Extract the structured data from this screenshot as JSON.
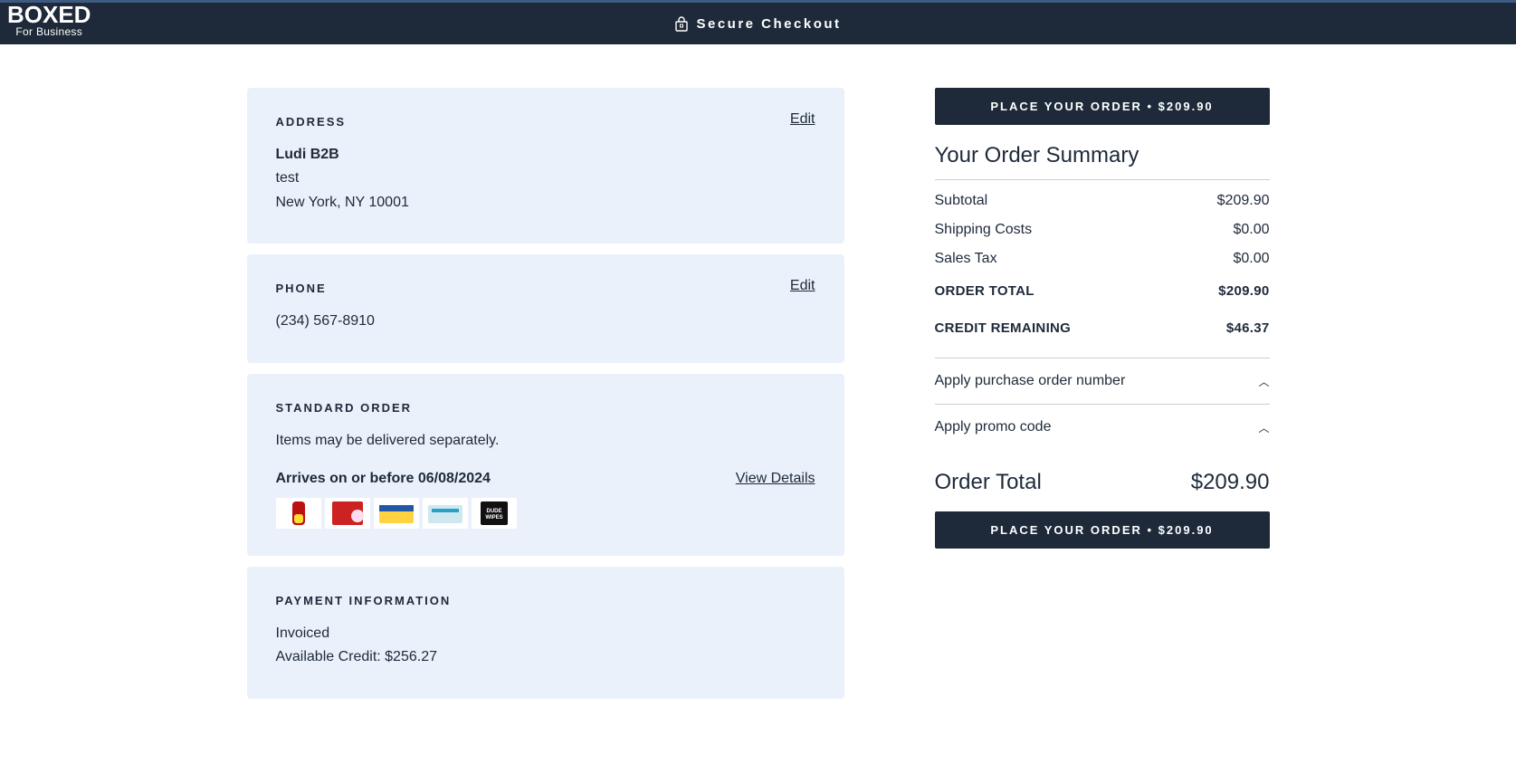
{
  "header": {
    "logo_main": "BOXED",
    "logo_sub": "For Business",
    "secure": "Secure Checkout"
  },
  "address": {
    "title": "ADDRESS",
    "edit": "Edit",
    "name": "Ludi B2B",
    "line1": "test",
    "city_line": "New York, NY 10001"
  },
  "phone": {
    "title": "PHONE",
    "edit": "Edit",
    "value": "(234) 567-8910"
  },
  "order": {
    "title": "STANDARD ORDER",
    "note": "Items may be delivered separately.",
    "arrives": "Arrives on or before 06/08/2024",
    "view": "View Details"
  },
  "payment": {
    "title": "PAYMENT INFORMATION",
    "method": "Invoiced",
    "credit": "Available Credit: $256.27"
  },
  "summary": {
    "place_top": "PLACE YOUR ORDER • $209.90",
    "title": "Your Order Summary",
    "subtotal_label": "Subtotal",
    "subtotal_val": "$209.90",
    "ship_label": "Shipping Costs",
    "ship_val": "$0.00",
    "tax_label": "Sales Tax",
    "tax_val": "$0.00",
    "total_label": "ORDER TOTAL",
    "total_val": "$209.90",
    "credit_label": "CREDIT REMAINING",
    "credit_val": "$46.37",
    "po": "Apply purchase order number",
    "promo": "Apply promo code",
    "grand_label": "Order Total",
    "grand_val": "$209.90",
    "place_bottom": "PLACE YOUR ORDER • $209.90"
  }
}
